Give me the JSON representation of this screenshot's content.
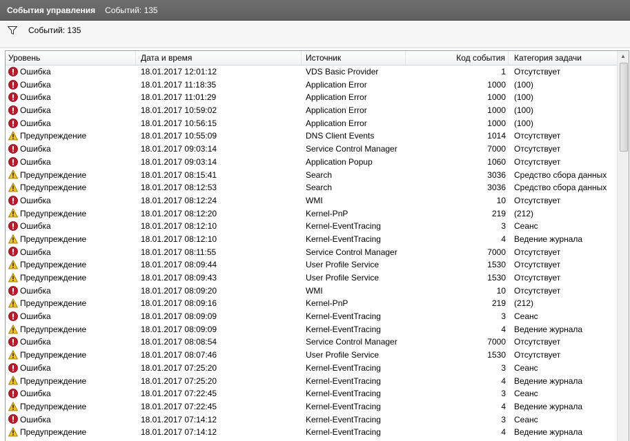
{
  "window": {
    "title": "События управления",
    "count_label": "Событий: 135"
  },
  "filter": {
    "count_label": "Событий: 135",
    "icon": "filter-icon"
  },
  "columns": {
    "level": "Уровень",
    "date": "Дата и время",
    "source": "Источник",
    "code": "Код события",
    "category": "Категория задачи"
  },
  "level_icons": {
    "Ошибка": "error-icon",
    "Предупреждение": "warning-icon"
  },
  "colors": {
    "error": "#c0182a",
    "warning": "#f3c316",
    "titlebar": "#666666"
  },
  "rows": [
    {
      "level": "Ошибка",
      "date": "18.01.2017 12:01:12",
      "source": "VDS Basic Provider",
      "code": "1",
      "category": "Отсутствует"
    },
    {
      "level": "Ошибка",
      "date": "18.01.2017 11:18:35",
      "source": "Application Error",
      "code": "1000",
      "category": "(100)"
    },
    {
      "level": "Ошибка",
      "date": "18.01.2017 11:01:29",
      "source": "Application Error",
      "code": "1000",
      "category": "(100)"
    },
    {
      "level": "Ошибка",
      "date": "18.01.2017 10:59:02",
      "source": "Application Error",
      "code": "1000",
      "category": "(100)"
    },
    {
      "level": "Ошибка",
      "date": "18.01.2017 10:56:15",
      "source": "Application Error",
      "code": "1000",
      "category": "(100)"
    },
    {
      "level": "Предупреждение",
      "date": "18.01.2017 10:55:09",
      "source": "DNS Client Events",
      "code": "1014",
      "category": "Отсутствует"
    },
    {
      "level": "Ошибка",
      "date": "18.01.2017 09:03:14",
      "source": "Service Control Manager",
      "code": "7000",
      "category": "Отсутствует"
    },
    {
      "level": "Ошибка",
      "date": "18.01.2017 09:03:14",
      "source": "Application Popup",
      "code": "1060",
      "category": "Отсутствует"
    },
    {
      "level": "Предупреждение",
      "date": "18.01.2017 08:15:41",
      "source": "Search",
      "code": "3036",
      "category": "Средство сбора данных"
    },
    {
      "level": "Предупреждение",
      "date": "18.01.2017 08:12:53",
      "source": "Search",
      "code": "3036",
      "category": "Средство сбора данных"
    },
    {
      "level": "Ошибка",
      "date": "18.01.2017 08:12:24",
      "source": "WMI",
      "code": "10",
      "category": "Отсутствует"
    },
    {
      "level": "Предупреждение",
      "date": "18.01.2017 08:12:20",
      "source": "Kernel-PnP",
      "code": "219",
      "category": "(212)"
    },
    {
      "level": "Ошибка",
      "date": "18.01.2017 08:12:10",
      "source": "Kernel-EventTracing",
      "code": "3",
      "category": "Сеанс"
    },
    {
      "level": "Предупреждение",
      "date": "18.01.2017 08:12:10",
      "source": "Kernel-EventTracing",
      "code": "4",
      "category": "Ведение журнала"
    },
    {
      "level": "Ошибка",
      "date": "18.01.2017 08:11:55",
      "source": "Service Control Manager",
      "code": "7000",
      "category": "Отсутствует"
    },
    {
      "level": "Предупреждение",
      "date": "18.01.2017 08:09:44",
      "source": "User Profile Service",
      "code": "1530",
      "category": "Отсутствует"
    },
    {
      "level": "Предупреждение",
      "date": "18.01.2017 08:09:43",
      "source": "User Profile Service",
      "code": "1530",
      "category": "Отсутствует"
    },
    {
      "level": "Ошибка",
      "date": "18.01.2017 08:09:20",
      "source": "WMI",
      "code": "10",
      "category": "Отсутствует"
    },
    {
      "level": "Предупреждение",
      "date": "18.01.2017 08:09:16",
      "source": "Kernel-PnP",
      "code": "219",
      "category": "(212)"
    },
    {
      "level": "Ошибка",
      "date": "18.01.2017 08:09:09",
      "source": "Kernel-EventTracing",
      "code": "3",
      "category": "Сеанс"
    },
    {
      "level": "Предупреждение",
      "date": "18.01.2017 08:09:09",
      "source": "Kernel-EventTracing",
      "code": "4",
      "category": "Ведение журнала"
    },
    {
      "level": "Ошибка",
      "date": "18.01.2017 08:08:54",
      "source": "Service Control Manager",
      "code": "7000",
      "category": "Отсутствует"
    },
    {
      "level": "Предупреждение",
      "date": "18.01.2017 08:07:46",
      "source": "User Profile Service",
      "code": "1530",
      "category": "Отсутствует"
    },
    {
      "level": "Ошибка",
      "date": "18.01.2017 07:25:20",
      "source": "Kernel-EventTracing",
      "code": "3",
      "category": "Сеанс"
    },
    {
      "level": "Предупреждение",
      "date": "18.01.2017 07:25:20",
      "source": "Kernel-EventTracing",
      "code": "4",
      "category": "Ведение журнала"
    },
    {
      "level": "Ошибка",
      "date": "18.01.2017 07:22:45",
      "source": "Kernel-EventTracing",
      "code": "3",
      "category": "Сеанс"
    },
    {
      "level": "Предупреждение",
      "date": "18.01.2017 07:22:45",
      "source": "Kernel-EventTracing",
      "code": "4",
      "category": "Ведение журнала"
    },
    {
      "level": "Ошибка",
      "date": "18.01.2017 07:14:12",
      "source": "Kernel-EventTracing",
      "code": "3",
      "category": "Сеанс"
    },
    {
      "level": "Предупреждение",
      "date": "18.01.2017 07:14:12",
      "source": "Kernel-EventTracing",
      "code": "4",
      "category": "Ведение журнала"
    }
  ]
}
